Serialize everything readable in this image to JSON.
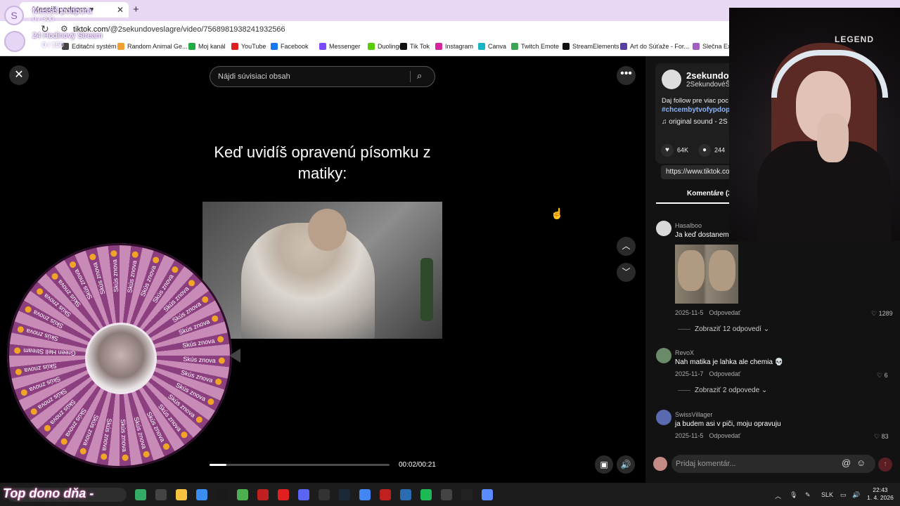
{
  "browser": {
    "tab_title": "Messiš podpora ♥",
    "url_host": "tiktok.com",
    "url_path": "/@2sekundoveslagre/video/7568981938241932566",
    "bookmarks": [
      {
        "label": "Editační systém",
        "color": "#444"
      },
      {
        "label": "Random Animal Ge...",
        "color": "#f0a030"
      },
      {
        "label": "Moj kanál",
        "color": "#22aa44"
      },
      {
        "label": "YouTube",
        "color": "#e02020"
      },
      {
        "label": "Facebook",
        "color": "#1877f2"
      },
      {
        "label": "Messenger",
        "color": "#7b4bff"
      },
      {
        "label": "Duolingo",
        "color": "#58cc02"
      },
      {
        "label": "Tik Tok",
        "color": "#111"
      },
      {
        "label": "Instagram",
        "color": "#d6249f"
      },
      {
        "label": "Canva",
        "color": "#19b3c8"
      },
      {
        "label": "Twitch Emote",
        "color": "#3aa655"
      },
      {
        "label": "StreamElements",
        "color": "#111"
      },
      {
        "label": "Art do Súťaže - For...",
        "color": "#5a3ea0"
      },
      {
        "label": "Slečna Exis",
        "color": "#a060c0"
      }
    ]
  },
  "overlay": {
    "goal_title": "Messiš podpora",
    "goal_count": "0 / 300",
    "stream_title": "24 Hodinový Stream",
    "stream_count": "0 / 150",
    "top_dono": "Top dono dňa -"
  },
  "tiktok": {
    "search_placeholder": "Nájdi súvisiaci obsah",
    "caption": "Keď uvidíš opravenú písomku z matiky:",
    "time": "00:02/00:21",
    "progress_fraction": 0.095,
    "author": {
      "name": "2sekundov",
      "handle": "2SekundovéŠl",
      "description": "Daj follow pre viac poc",
      "hashtag": "#chcembytvofypdopi",
      "sound": "original sound - 2S",
      "likes": "64K",
      "comments_count": "244",
      "link": "https://www.tiktok.co"
    },
    "comments_tab": "Komentáre (2",
    "comments": [
      {
        "user": "Hasalboo",
        "text": "Ja keď dostanem",
        "date": "2025-11-5",
        "reply": "Odpovedať",
        "likes": "1289",
        "more_replies": "Zobraziť 12 odpovedí",
        "avatar_color": "#d9d9d9"
      },
      {
        "user": "RevoX",
        "text": "Nah matika je lahka ale chemia 💀",
        "date": "2025-11-7",
        "reply": "Odpovedať",
        "likes": "6",
        "more_replies": "Zobraziť 2 odpovede",
        "avatar_color": "#6a8a6a"
      },
      {
        "user": "SwissVillager",
        "text": "ja budem asi v piči, moju opravuju",
        "date": "2025-11-5",
        "reply": "Odpovedať",
        "likes": "83",
        "more_replies": "",
        "avatar_color": "#5a6ab0"
      }
    ],
    "comment_placeholder": "Pridaj komentár..."
  },
  "webcam": {
    "logo": "LEGEND"
  },
  "wheel": {
    "labels": [
      "Skús znova",
      "Skús znova",
      "Skús znova",
      "Skús znova",
      "Skús znova",
      "Skús znova",
      "Skús znova",
      "Skús znova",
      "Skús znova",
      "Skús znova",
      "Skús znova",
      "Skús znova",
      "Skús znova",
      "Skús znova",
      "Skús znova",
      "Green Hell Stream",
      "Skús znova",
      "Skús znova",
      "Skús znova",
      "Skús znova",
      "Skús znova",
      "Skús znova",
      "Skús znova",
      "Skús znova",
      "Skús znova",
      "Skús znova",
      "Skús znova",
      "Skús znova",
      "Skús znova",
      "Skús znova"
    ]
  },
  "taskbar": {
    "lang": "SLK",
    "time": "22:43",
    "date": "1. 4. 2026",
    "apps": [
      "#3a6",
      "#444",
      "#f6c340",
      "#3a8ef0",
      "#1a1a1a",
      "#4caf50",
      "#c02020",
      "#e02020",
      "#5865f2",
      "#333",
      "#1b2838",
      "#4285f4",
      "#c02020",
      "#2b6cb0",
      "#1db954",
      "#444",
      "#222",
      "#5b8cff"
    ]
  }
}
